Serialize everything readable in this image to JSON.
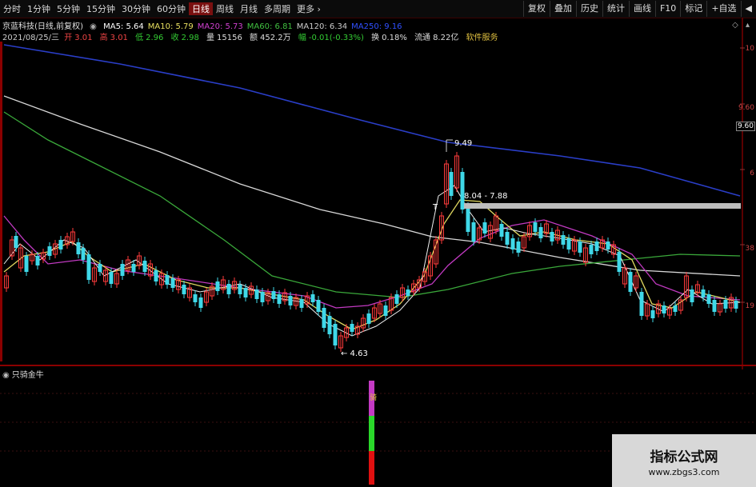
{
  "toolbar": {
    "timeframes": [
      "分时",
      "1分钟",
      "5分钟",
      "15分钟",
      "30分钟",
      "60分钟",
      "日线",
      "周线",
      "月线",
      "多周期",
      "更多 ›"
    ],
    "active_index": 6,
    "right_buttons": [
      "复权",
      "叠加",
      "历史",
      "统计",
      "画线",
      "F10",
      "标记",
      "+自选",
      "◀"
    ]
  },
  "stock": {
    "name": "京蓝科技(日线,前复权)",
    "ma": [
      {
        "label": "MA5: 5.64",
        "color": "#ffffff"
      },
      {
        "label": "MA10: 5.79",
        "color": "#e8e060"
      },
      {
        "label": "MA20: 5.73",
        "color": "#d040d0"
      },
      {
        "label": "MA60: 6.81",
        "color": "#40c040"
      },
      {
        "label": "MA120: 6.34",
        "color": "#cccccc"
      },
      {
        "label": "MA250: 9.16",
        "color": "#3050ff"
      }
    ]
  },
  "info": {
    "date": "2021/08/25/三",
    "open_label": "开",
    "open": "3.01",
    "high_label": "高",
    "high": "3.01",
    "low_label": "低",
    "low": "2.96",
    "close_label": "收",
    "close": "2.98",
    "vol_label": "量",
    "vol": "15156",
    "amt_label": "额",
    "amt": "452.2万",
    "chg_label": "幅",
    "chg": "-0.01(-0.33%)",
    "turn_label": "换",
    "turn": "0.18%",
    "float_label": "流通",
    "float": "8.22亿",
    "service": "软件服务"
  },
  "top_icons": [
    "◇",
    "▴"
  ],
  "chart_data": {
    "type": "candlestick",
    "annotations": {
      "high_peak": "9.49",
      "low_trough": "4.63",
      "range_box": "8.04 - 7.88",
      "t_marker": "T"
    },
    "axis_labels": [
      "10",
      "9.60",
      "6",
      "38",
      "19"
    ],
    "price_tag": "9.60",
    "indicator": {
      "title": "只骑金牛",
      "bar_label": "骑"
    }
  },
  "watermark": {
    "line1": "指标公式网",
    "line2": "www.zbgs3.com"
  }
}
